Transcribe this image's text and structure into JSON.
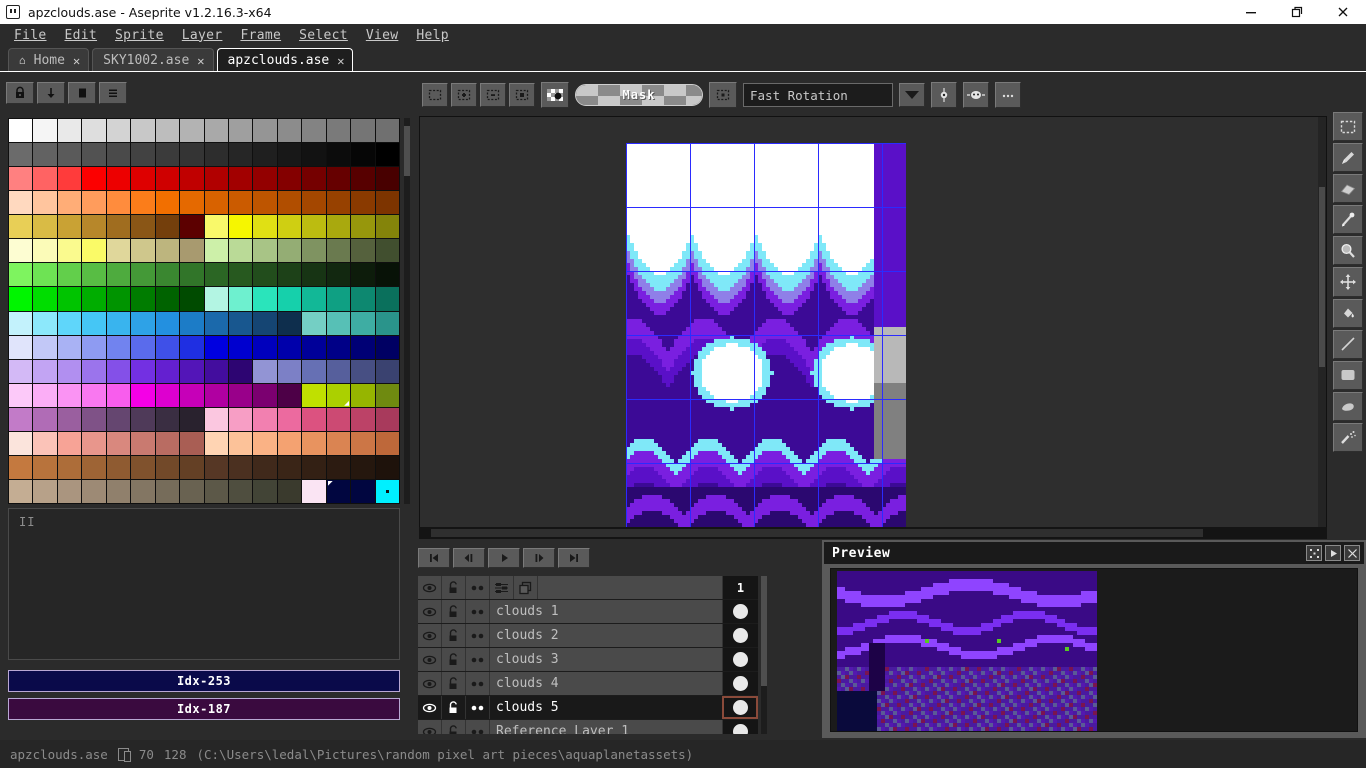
{
  "window": {
    "title": "apzclouds.ase - Aseprite v1.2.16.3-x64",
    "app_icon": "aseprite-icon",
    "minimize": "minimize-icon",
    "maximize": "restore-icon",
    "close": "close-icon"
  },
  "menu": [
    {
      "label": "File"
    },
    {
      "label": "Edit"
    },
    {
      "label": "Sprite"
    },
    {
      "label": "Layer"
    },
    {
      "label": "Frame"
    },
    {
      "label": "Select"
    },
    {
      "label": "View"
    },
    {
      "label": "Help"
    }
  ],
  "tabs": [
    {
      "label": "Home",
      "icon": "home-icon",
      "active": false,
      "close": "✕"
    },
    {
      "label": "SKY1002.ase",
      "active": false,
      "close": "✕"
    },
    {
      "label": "apzclouds.ase",
      "active": true,
      "close": "✕"
    }
  ],
  "palette_tools": [
    {
      "name": "lock-palette-button",
      "icon": "lock-icon"
    },
    {
      "name": "load-palette-button",
      "icon": "arrow-down-icon"
    },
    {
      "name": "save-palette-button",
      "icon": "page-icon"
    },
    {
      "name": "palette-options-button",
      "icon": "hamburger-icon"
    }
  ],
  "palette": {
    "rows": 16,
    "cols": 16,
    "colors": [
      "#ffffff",
      "#f5f5f5",
      "#e9e9e9",
      "#dedede",
      "#d3d3d3",
      "#c8c8c8",
      "#bdbdbd",
      "#b3b3b3",
      "#a9a9a9",
      "#9f9f9f",
      "#959595",
      "#8c8c8c",
      "#838383",
      "#7a7a7a",
      "#757575",
      "#707070",
      "#6b6b6b",
      "#626262",
      "#5a5a5a",
      "#525252",
      "#4a4a4a",
      "#424242",
      "#3b3b3b",
      "#343434",
      "#2d2d2d",
      "#262626",
      "#1f1f1f",
      "#181818",
      "#121212",
      "#0c0c0c",
      "#060606",
      "#000000",
      "#ff8080",
      "#ff6363",
      "#ff3b3b",
      "#fc0000",
      "#ed0000",
      "#de0000",
      "#cf0000",
      "#c00000",
      "#b10000",
      "#a20000",
      "#930000",
      "#840000",
      "#750000",
      "#660000",
      "#570000",
      "#480000",
      "#ffd9bf",
      "#ffc59e",
      "#ffad77",
      "#ff9c5c",
      "#ff8c3d",
      "#fb7d1a",
      "#f26f00",
      "#e56900",
      "#d86200",
      "#cb5b00",
      "#be5500",
      "#b14e00",
      "#a44700",
      "#974100",
      "#8a3a00",
      "#7d3400",
      "#e8cf56",
      "#d9bb45",
      "#c9a234",
      "#b7872a",
      "#a06d1f",
      "#8a5616",
      "#743f0c",
      "#5c0000",
      "#f9f96a",
      "#f6f600",
      "#e0e014",
      "#cfcf12",
      "#bcbc10",
      "#a9a90e",
      "#97970c",
      "#84840a",
      "#fdfdd2",
      "#fbfbb8",
      "#fafa8e",
      "#fafa67",
      "#e0d79b",
      "#cfc78c",
      "#bdb57e",
      "#a89a6f",
      "#cdf0a9",
      "#bada97",
      "#a8c486",
      "#94ad74",
      "#7f9361",
      "#6a7a4f",
      "#55613d",
      "#414f2f",
      "#7ef45f",
      "#6ee354",
      "#62cf4b",
      "#58bd44",
      "#4eab3e",
      "#449937",
      "#3a8730",
      "#317529",
      "#2b6624",
      "#27591f",
      "#224d1c",
      "#1d4118",
      "#173414",
      "#122810",
      "#0d1c0b",
      "#081207",
      "#00f500",
      "#00dd00",
      "#00c400",
      "#00ad00",
      "#009400",
      "#007c00",
      "#006300",
      "#004b00",
      "#b3f5e3",
      "#6ef0cf",
      "#2ae4bb",
      "#16d0ab",
      "#12b897",
      "#0fa083",
      "#0d8870",
      "#0a705c",
      "#c3f2fc",
      "#8ce8fb",
      "#5fd6fa",
      "#45c6f5",
      "#39b4ee",
      "#2ea2e7",
      "#2390e0",
      "#1c7cc7",
      "#1b69ab",
      "#18578f",
      "#154573",
      "#0e2e4d",
      "#74cfc4",
      "#57c0b6",
      "#3eada3",
      "#2a948b",
      "#e0e4fb",
      "#c2c8f7",
      "#a9b2f4",
      "#8e9bf2",
      "#7183ef",
      "#5a6bec",
      "#3f50e8",
      "#1f2fe2",
      "#0000e0",
      "#0000cf",
      "#0000bd",
      "#0000ab",
      "#000099",
      "#000087",
      "#000075",
      "#000063",
      "#d3b9f6",
      "#c2a4f3",
      "#b18ff0",
      "#9b74ec",
      "#8450e8",
      "#7330e2",
      "#6420d0",
      "#5315b8",
      "#430d9e",
      "#2d0572",
      "#9294d4",
      "#7c80c6",
      "#6670b4",
      "#565f9c",
      "#474f83",
      "#3a4270",
      "#fcc9f9",
      "#fbaef6",
      "#fa93f3",
      "#f978f0",
      "#f85ded",
      "#f400e6",
      "#dd00cf",
      "#c600b8",
      "#b000a1",
      "#99008a",
      "#7b0070",
      "#4d0047",
      "#c0e000",
      "#abd000",
      "#96b500",
      "#6f8a10",
      "#c27bc8",
      "#b06cb6",
      "#9a5f9f",
      "#7f5287",
      "#654670",
      "#4f3a59",
      "#3a2e42",
      "#29222e",
      "#fbc7e0",
      "#f79ec5",
      "#f280b0",
      "#ec6a9f",
      "#dc5280",
      "#cc4a73",
      "#bc4267",
      "#a83a5c",
      "#fbe4dc",
      "#fbc3b8",
      "#f7a396",
      "#e8968c",
      "#d9887e",
      "#c97a70",
      "#b96c62",
      "#a95e54",
      "#ffd4b3",
      "#fcc299",
      "#fab285",
      "#f4a271",
      "#e8935f",
      "#da8452",
      "#cc7646",
      "#be683a",
      "#c4793f",
      "#b8733c",
      "#ad6d39",
      "#9e6435",
      "#8f5b31",
      "#80522d",
      "#724929",
      "#644025",
      "#563725",
      "#4b3020",
      "#40291b",
      "#3a2517",
      "#332014",
      "#2c1b11",
      "#25170e",
      "#1e120b",
      "#c4ad93",
      "#b7a189",
      "#aa957f",
      "#9d8a75",
      "#90806c",
      "#837663",
      "#766c5a",
      "#696251",
      "#5c5848",
      "#4f4e3f",
      "#424436",
      "#3a3a2d",
      "#fae4f3",
      "#010640",
      "#010640",
      "#00f0ff"
    ],
    "selected_fg_index": 253,
    "selected_bg_index": 187
  },
  "color_indices": {
    "fg_label": "Idx-253",
    "fg_color": "#0a0a4a",
    "bg_label": "Idx-187",
    "bg_color": "#3a0a3f",
    "scroll_glyph": "II"
  },
  "context_toolbar": {
    "selection_modes": [
      {
        "name": "selection-replace-button",
        "icon": "marquee-replace-icon"
      },
      {
        "name": "selection-add-button",
        "icon": "marquee-add-icon"
      },
      {
        "name": "selection-subtract-button",
        "icon": "marquee-subtract-icon"
      },
      {
        "name": "selection-intersect-button",
        "icon": "marquee-intersect-icon"
      }
    ],
    "transparent_color_button": {
      "name": "transparent-color-button",
      "icon": "checker-color-icon"
    },
    "mask_label": "Mask",
    "pixel_perfect_button": {
      "name": "pixel-snap-button",
      "icon": "grid-dot-icon"
    },
    "rotation_algorithm": "Fast Rotation",
    "rotation_dropdown_icon": "chevron-down-icon",
    "pivot_button": {
      "name": "pivot-button",
      "icon": "pivot-icon"
    },
    "onion_button": {
      "name": "onion-skin-button",
      "icon": "onion-skin-icon"
    },
    "more_button": {
      "name": "more-options-button",
      "icon": "ellipsis-icon"
    }
  },
  "tools": [
    {
      "name": "rectangular-marquee-tool",
      "icon": "marquee-icon"
    },
    {
      "name": "pencil-tool",
      "icon": "pencil-icon"
    },
    {
      "name": "eraser-tool",
      "icon": "eraser-icon"
    },
    {
      "name": "eyedropper-tool",
      "icon": "eyedropper-icon"
    },
    {
      "name": "zoom-tool",
      "icon": "magnifier-icon"
    },
    {
      "name": "move-tool",
      "icon": "move-arrows-icon"
    },
    {
      "name": "paint-bucket-tool",
      "icon": "paint-bucket-icon"
    },
    {
      "name": "line-tool",
      "icon": "line-icon"
    },
    {
      "name": "rectangle-tool",
      "icon": "rectangle-icon"
    },
    {
      "name": "blur-tool",
      "icon": "blur-icon"
    },
    {
      "name": "spray-tool",
      "icon": "spray-icon"
    }
  ],
  "playback": [
    {
      "name": "go-first-frame-button",
      "icon": "skip-back-icon"
    },
    {
      "name": "go-previous-frame-button",
      "icon": "step-back-icon"
    },
    {
      "name": "play-animation-button",
      "icon": "play-icon"
    },
    {
      "name": "go-next-frame-button",
      "icon": "step-forward-icon"
    },
    {
      "name": "go-last-frame-button",
      "icon": "skip-forward-icon"
    }
  ],
  "layers": {
    "header": {
      "eye": "eye-icon",
      "lock": "padlock-open-icon",
      "link": "continuous-dots-icon",
      "props": "layer-properties-icon",
      "new": "new-layer-icon",
      "frame_number": "1"
    },
    "rows": [
      {
        "name": "clouds 1",
        "visible": true,
        "locked": false,
        "active": false
      },
      {
        "name": "clouds 2",
        "visible": true,
        "locked": false,
        "active": false
      },
      {
        "name": "clouds 3",
        "visible": true,
        "locked": false,
        "active": false
      },
      {
        "name": "clouds 4",
        "visible": true,
        "locked": false,
        "active": false
      },
      {
        "name": "clouds 5",
        "visible": true,
        "locked": false,
        "active": true
      },
      {
        "name": "Reference Layer 1",
        "visible": true,
        "locked": false,
        "active": false
      }
    ]
  },
  "preview": {
    "title": "Preview",
    "buttons": [
      {
        "name": "preview-center-button",
        "icon": "center-icon"
      },
      {
        "name": "preview-play-button",
        "icon": "play-icon"
      },
      {
        "name": "preview-close-button",
        "icon": "close-x-icon"
      }
    ]
  },
  "status": {
    "filename": "apzclouds.ase",
    "size_icon": "document-size-icon",
    "width": "70",
    "height": "128",
    "path": "(C:\\Users\\ledal\\Pictures\\random pixel art pieces\\aquaplanetassets)"
  },
  "canvas": {
    "grid_color": "#2b2bff",
    "bg_color": "#2e2e2e",
    "sprite_width": 70,
    "sprite_height": 128,
    "zoom": "4"
  }
}
